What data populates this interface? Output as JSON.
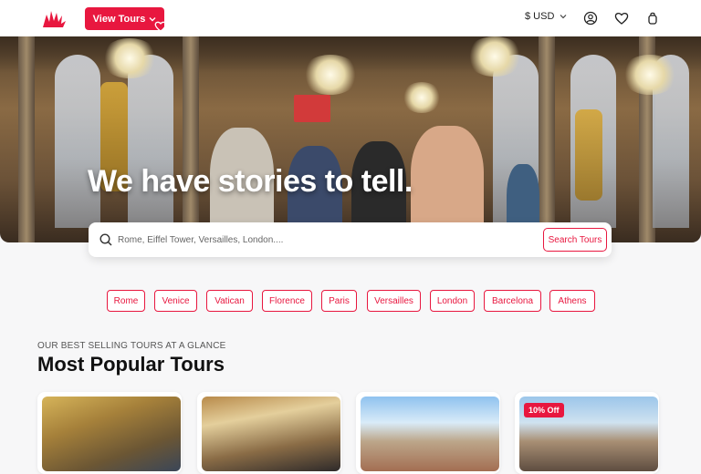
{
  "header": {
    "view_tours_label": "View Tours",
    "currency_label": "$ USD"
  },
  "hero": {
    "title": "We have stories to tell."
  },
  "search": {
    "placeholder": "Rome, Eiffel Tower, Versailles, London....",
    "button_label": "Search Tours"
  },
  "destinations": [
    "Rome",
    "Venice",
    "Vatican",
    "Florence",
    "Paris",
    "Versailles",
    "London",
    "Barcelona",
    "Athens"
  ],
  "section": {
    "eyebrow": "OUR BEST SELLING TOURS AT A GLANCE",
    "title": "Most Popular Tours"
  },
  "cards": [
    {
      "badge": ""
    },
    {
      "badge": ""
    },
    {
      "badge": ""
    },
    {
      "badge": "10% Off"
    }
  ],
  "colors": {
    "accent": "#e8173f",
    "background": "#f7f7f8"
  },
  "icons": [
    "logo-icon",
    "chevron-down-icon",
    "user-icon",
    "heart-icon",
    "bag-icon",
    "search-icon"
  ]
}
